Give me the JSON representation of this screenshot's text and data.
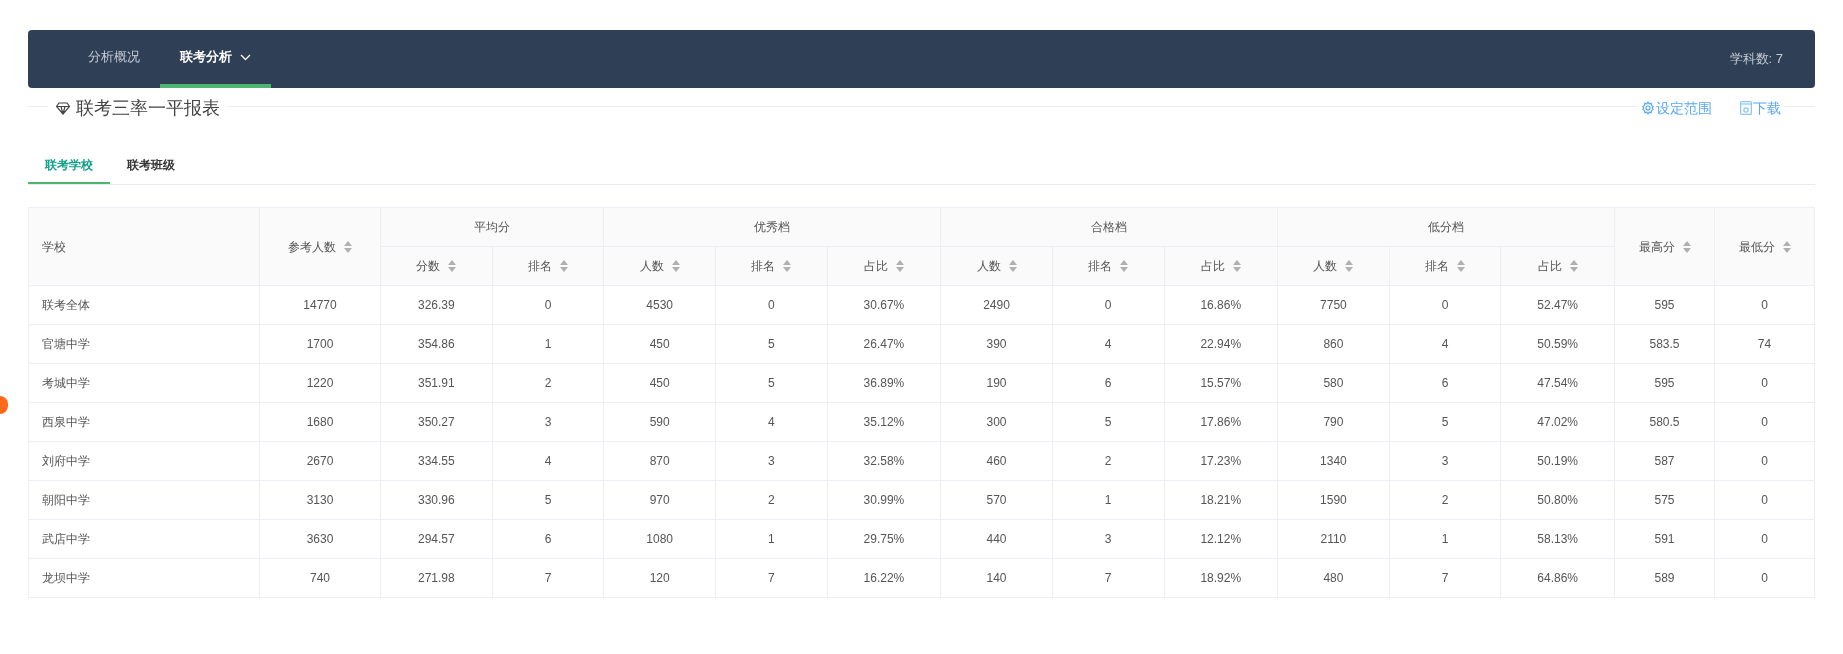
{
  "nav": {
    "tabs": [
      {
        "label": "分析概况",
        "selected": false,
        "dropdown": false
      },
      {
        "label": "联考分析",
        "selected": true,
        "dropdown": true
      }
    ],
    "subject_count": "学科数: 7"
  },
  "report": {
    "title": "联考三率一平报表",
    "actions": [
      {
        "label": "设定范围",
        "kind": "settings"
      },
      {
        "label": "下载",
        "kind": "download"
      }
    ]
  },
  "subtabs": [
    {
      "label": "联考学校",
      "selected": true
    },
    {
      "label": "联考班级",
      "selected": false
    }
  ],
  "table": {
    "columns": [
      {
        "label": "学校",
        "sortable": false
      },
      {
        "label": "参考人数",
        "sortable": true
      },
      {
        "label": "平均分",
        "colspan": 2,
        "children": [
          {
            "label": "分数",
            "sortable": true
          },
          {
            "label": "排名",
            "sortable": true
          }
        ]
      },
      {
        "label": "优秀档",
        "colspan": 3,
        "children": [
          {
            "label": "人数",
            "sortable": true
          },
          {
            "label": "排名",
            "sortable": true
          },
          {
            "label": "占比",
            "sortable": true
          }
        ]
      },
      {
        "label": "合格档",
        "colspan": 3,
        "children": [
          {
            "label": "人数",
            "sortable": true
          },
          {
            "label": "排名",
            "sortable": true
          },
          {
            "label": "占比",
            "sortable": true
          }
        ]
      },
      {
        "label": "低分档",
        "colspan": 3,
        "children": [
          {
            "label": "人数",
            "sortable": true
          },
          {
            "label": "排名",
            "sortable": true
          },
          {
            "label": "占比",
            "sortable": true
          }
        ]
      },
      {
        "label": "最高分",
        "sortable": true
      },
      {
        "label": "最低分",
        "sortable": true
      }
    ],
    "rows": [
      [
        "联考全体",
        "14770",
        "326.39",
        "0",
        "4530",
        "0",
        "30.67%",
        "2490",
        "0",
        "16.86%",
        "7750",
        "0",
        "52.47%",
        "595",
        "0"
      ],
      [
        "官塘中学",
        "1700",
        "354.86",
        "1",
        "450",
        "5",
        "26.47%",
        "390",
        "4",
        "22.94%",
        "860",
        "4",
        "50.59%",
        "583.5",
        "74"
      ],
      [
        "考城中学",
        "1220",
        "351.91",
        "2",
        "450",
        "5",
        "36.89%",
        "190",
        "6",
        "15.57%",
        "580",
        "6",
        "47.54%",
        "595",
        "0"
      ],
      [
        "西泉中学",
        "1680",
        "350.27",
        "3",
        "590",
        "4",
        "35.12%",
        "300",
        "5",
        "17.86%",
        "790",
        "5",
        "47.02%",
        "580.5",
        "0"
      ],
      [
        "刘府中学",
        "2670",
        "334.55",
        "4",
        "870",
        "3",
        "32.58%",
        "460",
        "2",
        "17.23%",
        "1340",
        "3",
        "50.19%",
        "587",
        "0"
      ],
      [
        "朝阳中学",
        "3130",
        "330.96",
        "5",
        "970",
        "2",
        "30.99%",
        "570",
        "1",
        "18.21%",
        "1590",
        "2",
        "50.80%",
        "575",
        "0"
      ],
      [
        "武店中学",
        "3630",
        "294.57",
        "6",
        "1080",
        "1",
        "29.75%",
        "440",
        "3",
        "12.12%",
        "2110",
        "1",
        "58.13%",
        "591",
        "0"
      ],
      [
        "龙坝中学",
        "740",
        "271.98",
        "7",
        "120",
        "7",
        "16.22%",
        "140",
        "7",
        "18.92%",
        "480",
        "7",
        "64.86%",
        "589",
        "0"
      ]
    ]
  }
}
